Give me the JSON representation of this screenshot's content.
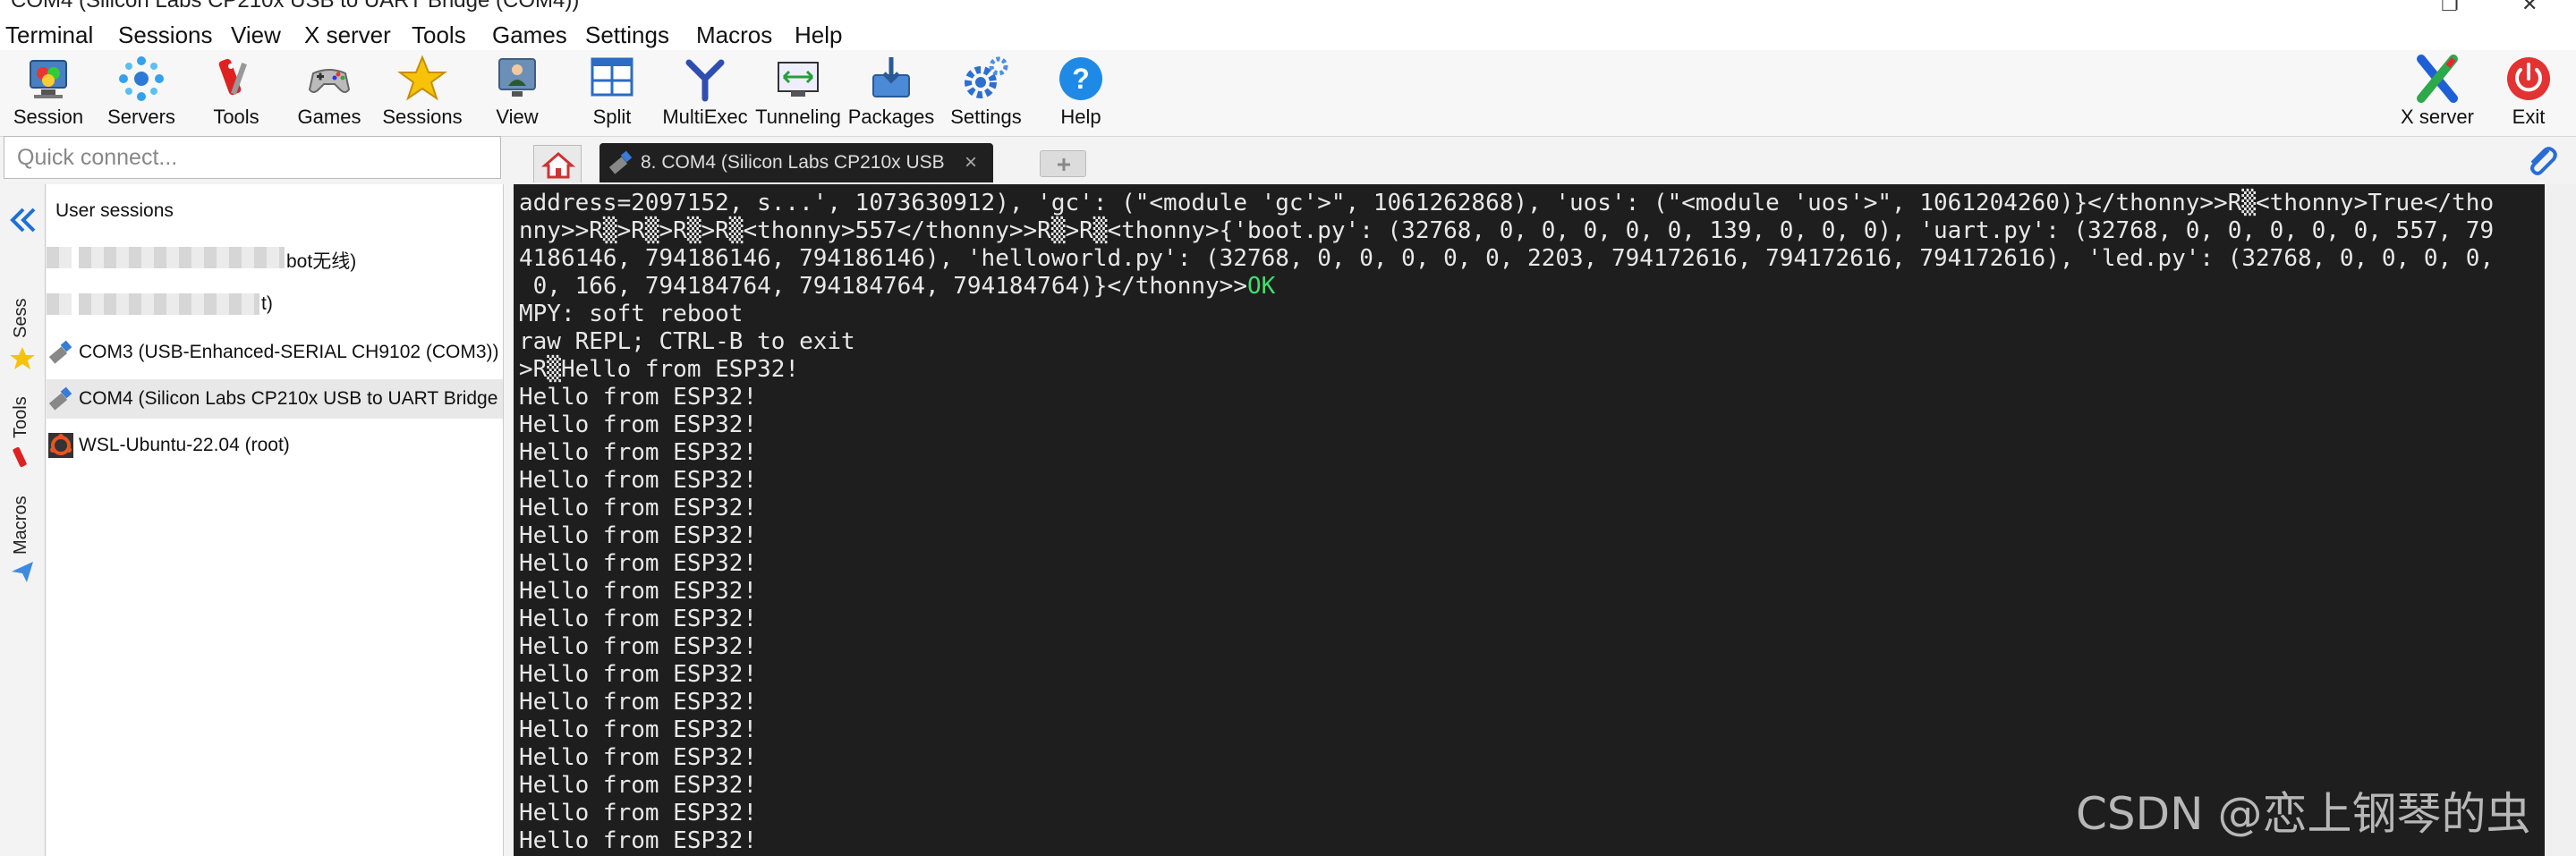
{
  "window": {
    "title": "COM4  (Silicon Labs CP210x USB to UART Bridge (COM4))"
  },
  "menu": [
    "Terminal",
    "Sessions",
    "View",
    "X server",
    "Tools",
    "Games",
    "Settings",
    "Macros",
    "Help"
  ],
  "toolbar": {
    "session": "Session",
    "servers": "Servers",
    "tools": "Tools",
    "games": "Games",
    "sessions": "Sessions",
    "view": "View",
    "split": "Split",
    "multiexec": "MultiExec",
    "tunneling": "Tunneling",
    "packages": "Packages",
    "settings": "Settings",
    "help": "Help",
    "xserver": "X server",
    "exit": "Exit"
  },
  "quick_connect": {
    "placeholder": "Quick connect..."
  },
  "tab": {
    "label": "8. COM4  (Silicon Labs CP210x USB",
    "close": "×"
  },
  "sidebar": {
    "sessions": "Sess",
    "tools": "Tools",
    "macros": "Macros"
  },
  "sessions": {
    "header": "User sessions",
    "item1_tail": "bot无线)",
    "item2_tail": "t)",
    "com3": "COM3  (USB-Enhanced-SERIAL CH9102 (COM3))",
    "com4": "COM4  (Silicon Labs CP210x USB to UART Bridge",
    "wsl": "WSL-Ubuntu-22.04 (root)"
  },
  "terminal": {
    "line1": "address=2097152, s...', 1073630912), 'gc': (\"<module 'gc'>\", 1061262868), 'uos': (\"<module 'uos'>\", 1061204260)}</thonny>>R▒<thonny>True</tho",
    "line2": "nny>>R▒>R▒>R▒>R▒<thonny>557</thonny>>R▒>R▒<thonny>{'boot.py': (32768, 0, 0, 0, 0, 0, 139, 0, 0, 0), 'uart.py': (32768, 0, 0, 0, 0, 0, 557, 79",
    "line3": "4186146, 794186146, 794186146), 'helloworld.py': (32768, 0, 0, 0, 0, 0, 2203, 794172616, 794172616, 794172616), 'led.py': (32768, 0, 0, 0, 0,",
    "line4": " 0, 166, 794184764, 794184764, 794184764)}</thonny>>",
    "ok": "OK",
    "line5": "MPY: soft reboot",
    "line6": "raw REPL; CTRL-B to exit",
    "line7": ">R▒Hello from ESP32!",
    "hello": "Hello from ESP32!"
  },
  "watermark": "CSDN @恋上钢琴的虫",
  "colors": {
    "terminal_bg": "#1e1e1e",
    "terminal_fg": "#e8e8e8",
    "ok": "#3ee06b"
  }
}
